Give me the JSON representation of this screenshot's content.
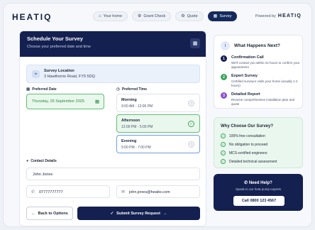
{
  "header": {
    "logo": "HEATIQ",
    "nav": [
      {
        "label": "Your home",
        "icon": "home-icon",
        "glyph": "⌂"
      },
      {
        "label": "Grant Check",
        "icon": "settings-icon",
        "glyph": "⚙"
      },
      {
        "label": "Quote",
        "icon": "settings-icon",
        "glyph": "⚙"
      },
      {
        "label": "Survey",
        "icon": "calendar-icon",
        "glyph": "▦"
      }
    ],
    "powered_by": "Powered by",
    "powered_logo": "HEATIQ"
  },
  "main": {
    "title": "Schedule Your Survey",
    "subtitle": "Choose your preferred date and time",
    "location_label": "Survey Location",
    "location_address": "3 Hawthorne Road, FY5 5DQ",
    "date_label": "Preferred Date",
    "date_value": "Thursday, 25 September 2025",
    "time_label": "Preferred Time",
    "slots": [
      {
        "name": "Morning",
        "time": "9:00 AM - 12:00 PM"
      },
      {
        "name": "Afternoon",
        "time": "12:00 PM - 5:00 PM"
      },
      {
        "name": "Evening",
        "time": "5:00 PM - 7:00 PM"
      }
    ],
    "contact_label": "Contact Details",
    "name_value": "John Jones",
    "phone_value": "07777777777",
    "email_value": "john.jones@heatio.com",
    "back_label": "Back to Options",
    "submit_label": "Submit Survey Request"
  },
  "what_happens": {
    "title": "What Happens Next?",
    "steps": [
      {
        "n": "1",
        "title": "Confirmation Call",
        "desc": "We'll contact you within 24 hours to confirm your appointment",
        "color": "#142050"
      },
      {
        "n": "2",
        "title": "Expert Survey",
        "desc": "Certified surveyor visits your home (usually 1-2 hours)",
        "color": "#3aa55a"
      },
      {
        "n": "3",
        "title": "Detailed Report",
        "desc": "Receive comprehensive installation plan and quote",
        "color": "#8a4fd0"
      }
    ]
  },
  "why": {
    "title": "Why Choose Our Survey?",
    "items": [
      "100% free consultation",
      "No obligation to proceed",
      "MCS-certified engineers",
      "Detailed technical assessment"
    ]
  },
  "help": {
    "title": "Need Help?",
    "subtitle": "Speak to our heat pump experts",
    "call_label": "Call 0800 123 4567"
  },
  "colors": {
    "brand_navy": "#142050",
    "success_green": "#3aa55a",
    "accent_blue": "#2a5fb8"
  }
}
